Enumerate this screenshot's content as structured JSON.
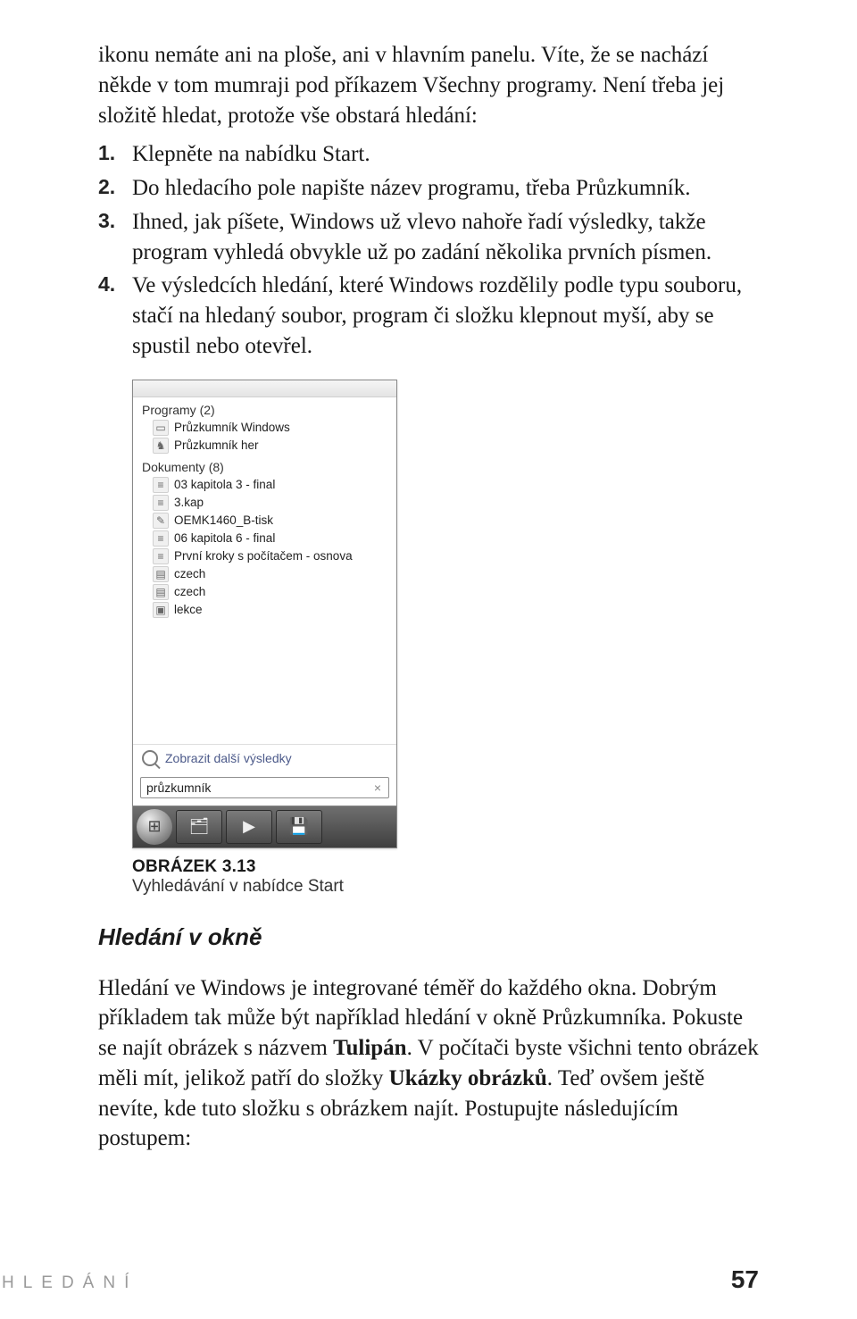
{
  "intro": "ikonu nemáte ani na ploše, ani v hlavním panelu. Víte, že se nachází někde v tom mumraji pod příkazem Všechny programy. Není třeba jej složitě hledat, protože vše obstará hledání:",
  "steps": [
    "Klepněte na nabídku Start.",
    "Do hledacího pole napište název programu, třeba Průzkumník.",
    "Ihned, jak píšete, Windows už vlevo nahoře řadí výsledky, takže program vyhledá obvykle už po zadání několika prvních písmen.",
    "Ve výsledcích hledání, které Windows rozdělily podle typu souboru, stačí na hledaný soubor, program či složku klepnout myší, aby se spustil nebo otevřel."
  ],
  "searchPanel": {
    "groups": [
      {
        "header": "Programy (2)",
        "items": [
          {
            "icon": "folder-icon",
            "glyph": "▭",
            "label": "Průzkumník Windows"
          },
          {
            "icon": "game-icon",
            "glyph": "♞",
            "label": "Průzkumník her"
          }
        ]
      },
      {
        "header": "Dokumenty (8)",
        "items": [
          {
            "icon": "doc-icon",
            "glyph": "≡",
            "label": "03 kapitola 3 - final"
          },
          {
            "icon": "doc-icon",
            "glyph": "≡",
            "label": "3.kap"
          },
          {
            "icon": "pdf-icon",
            "glyph": "✎",
            "label": "OEMK1460_B-tisk"
          },
          {
            "icon": "doc-icon",
            "glyph": "≡",
            "label": "06 kapitola 6 - final"
          },
          {
            "icon": "doc-icon",
            "glyph": "≡",
            "label": "První kroky s počítačem - osnova"
          },
          {
            "icon": "text-icon",
            "glyph": "▤",
            "label": "czech"
          },
          {
            "icon": "text-icon",
            "glyph": "▤",
            "label": "czech"
          },
          {
            "icon": "text-icon",
            "glyph": "▣",
            "label": "lekce"
          }
        ]
      }
    ],
    "moreResults": "Zobrazit další výsledky",
    "searchText": "průzkumník",
    "clearGlyph": "×",
    "taskbar": {
      "orbGlyph": "⊞",
      "buttons": [
        {
          "name": "explorer-button",
          "glyph": "🗂"
        },
        {
          "name": "media-button",
          "glyph": "▶"
        },
        {
          "name": "save-button",
          "glyph": "💾"
        }
      ]
    }
  },
  "figure": {
    "label": "OBRÁZEK 3.13",
    "caption": "Vyhledávání v nabídce Start"
  },
  "section2": {
    "heading": "Hledání v okně",
    "p_before_b1": "Hledání ve Windows je integrované téměř do každého okna. Dobrým příkladem tak může být například hledání v okně Průzkumníka. Pokuste se najít obrázek s názvem ",
    "b1": "Tulipán",
    "p_mid": ". V počítači byste všichni tento obrázek měli mít, jelikož patří do složky ",
    "b2": "Ukázky obrázků",
    "p_after": ". Teď ovšem ještě nevíte, kde tuto složku s obrázkem najít. Postupujte následujícím postupem:"
  },
  "footer": {
    "section": "HLEDÁNÍ",
    "page": "57"
  }
}
